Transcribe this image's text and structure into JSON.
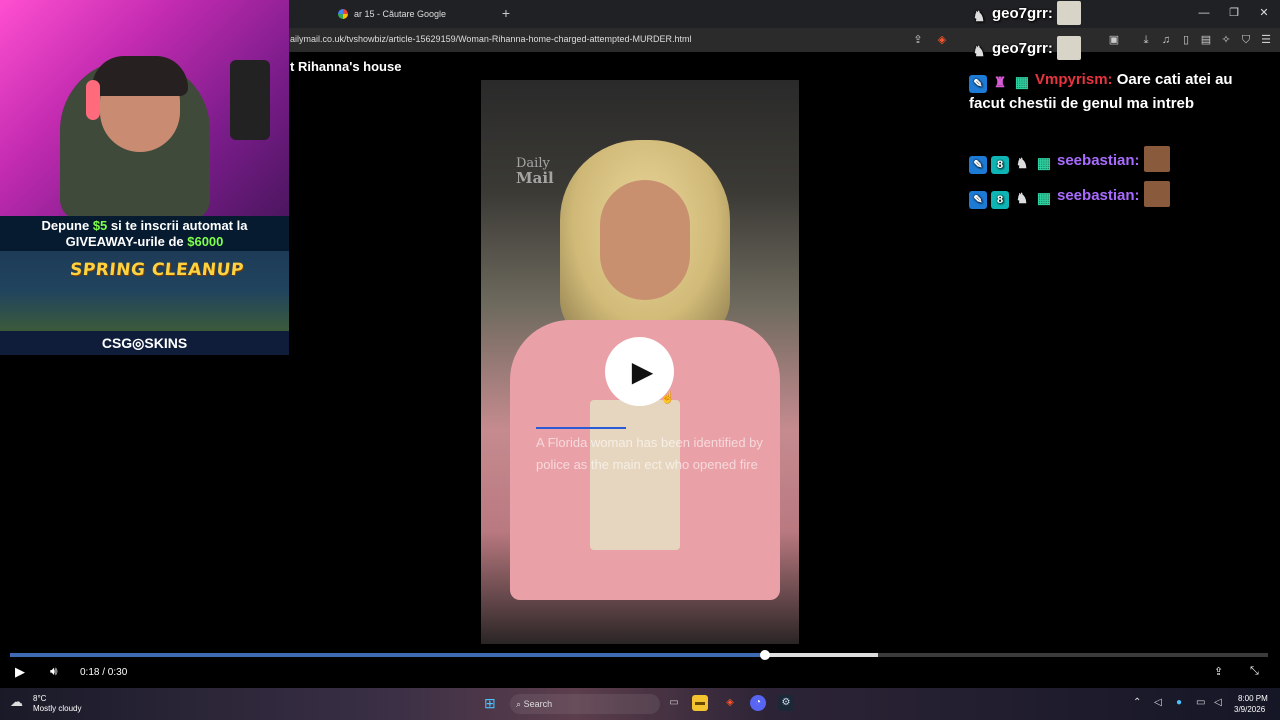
{
  "browser": {
    "tab_title": "ar 15 - Căutare Google",
    "new_tab_icon": "+",
    "url": "ailymail.co.uk/tvshowbiz/article-15629159/Woman-Rihanna-home-charged-attempted-MURDER.html",
    "window_controls": [
      "—",
      "❐",
      "✕"
    ]
  },
  "article": {
    "title": "t Rihanna's house"
  },
  "video": {
    "watermark_line1": "Daily",
    "watermark_line2": "Mail",
    "caption": "A Florida woman has been identified by police as the main ect who opened fire"
  },
  "player": {
    "time": "0:18 / 0:30",
    "progress_fraction": 0.6,
    "buffered_fraction": 0.69
  },
  "stream_overlay": {
    "giveaway_line1_a": "Depune ",
    "giveaway_line1_amount": "$5",
    "giveaway_line1_b": " si te inscrii automat la",
    "giveaway_line2_a": "GIVEAWAY-urile de ",
    "giveaway_line2_amount": "$6000",
    "promo_title": "SPRING CLEANUP",
    "brand": "CSG◎SKINS"
  },
  "chat": [
    {
      "user": "geo7grr:",
      "message": ""
    },
    {
      "user": "geo7grr:",
      "message": ""
    },
    {
      "user": "Vmpyrism:",
      "message": "Oare cati atei au facut chestii de genul ma intreb"
    },
    {
      "user": "seebastian:",
      "message": ""
    },
    {
      "user": "seebastian:",
      "message": ""
    }
  ],
  "taskbar": {
    "weather_temp": "8°C",
    "weather_desc": "Mostly cloudy",
    "search_label": "Search",
    "time": "8:00 PM",
    "date": "3/9/2026"
  }
}
